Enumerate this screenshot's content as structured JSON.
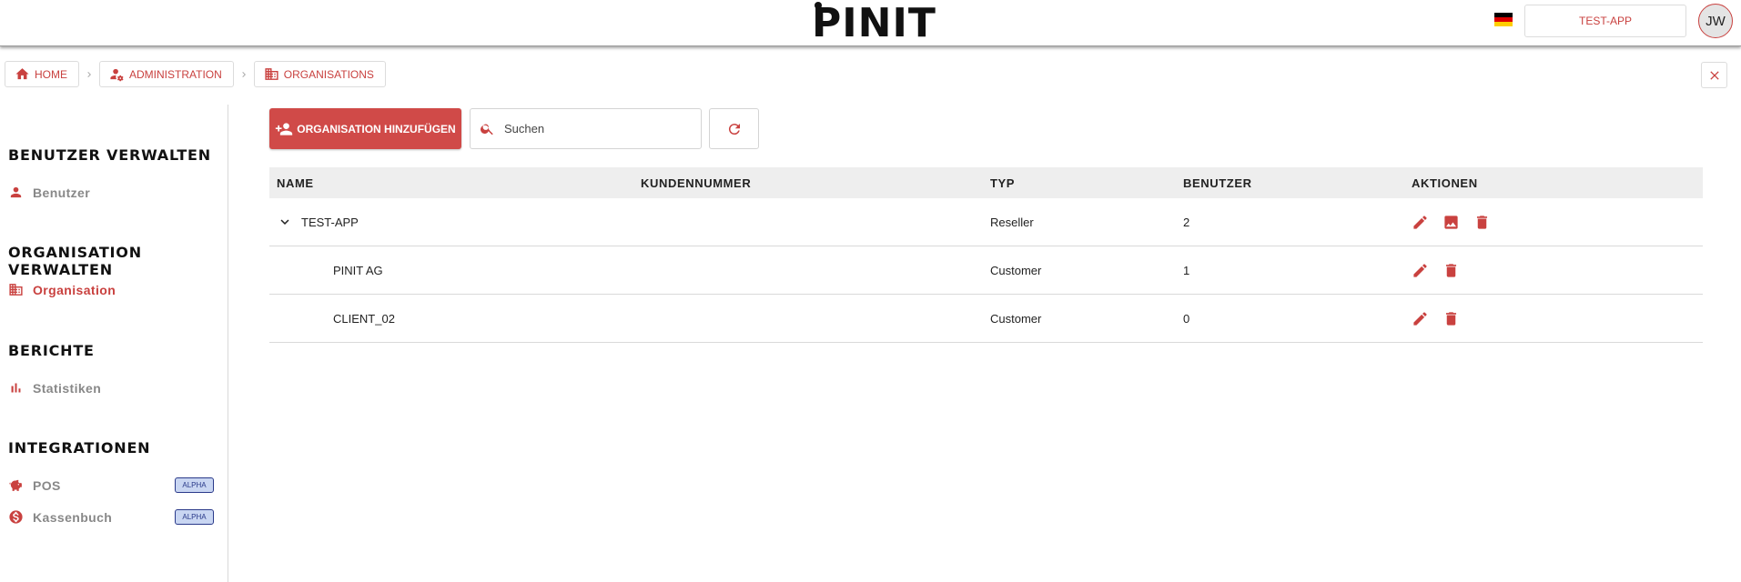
{
  "header": {
    "logo": "PINIT",
    "tenant_button": "TEST-APP",
    "avatar_initials": "JW",
    "flag_colors": [
      "#000000",
      "#dd0000",
      "#ffce00"
    ]
  },
  "breadcrumb": [
    {
      "label": "HOME",
      "icon": "home-icon"
    },
    {
      "label": "ADMINISTRATION",
      "icon": "admin-settings-icon"
    },
    {
      "label": "ORGANISATIONS",
      "icon": "building-icon"
    }
  ],
  "sidebar": {
    "sections": [
      {
        "title": "BENUTZER VERWALTEN",
        "items": [
          {
            "label": "Benutzer",
            "icon": "person-icon"
          }
        ]
      },
      {
        "title": "ORGANISATION VERWALTEN",
        "items": [
          {
            "label": "Organisation",
            "icon": "building-icon",
            "active": true
          }
        ]
      },
      {
        "title": "BERICHTE",
        "items": [
          {
            "label": "Statistiken",
            "icon": "bar-chart-icon"
          }
        ]
      },
      {
        "title": "INTEGRATIONEN",
        "items": [
          {
            "label": "POS",
            "icon": "piggy-bank-icon",
            "badge": "ALPHA"
          },
          {
            "label": "Kassenbuch",
            "icon": "dollar-coin-icon",
            "badge": "ALPHA"
          }
        ]
      }
    ]
  },
  "toolbar": {
    "add_label": "ORGANISATION HINZUFÜGEN",
    "search_placeholder": "Suchen"
  },
  "table": {
    "columns": [
      "NAME",
      "KUNDENNUMMER",
      "TYP",
      "BENUTZER",
      "AKTIONEN"
    ],
    "rows": [
      {
        "name": "TEST-APP",
        "kundennummer": "",
        "typ": "Reseller",
        "benutzer": "2",
        "expandable": true,
        "actions": [
          "edit-icon",
          "image-icon",
          "delete-icon"
        ]
      },
      {
        "name": "PINIT AG",
        "kundennummer": "",
        "typ": "Customer",
        "benutzer": "1",
        "expandable": false,
        "actions": [
          "edit-icon",
          "delete-icon"
        ]
      },
      {
        "name": "CLIENT_02",
        "kundennummer": "",
        "typ": "Customer",
        "benutzer": "0",
        "expandable": false,
        "actions": [
          "edit-icon",
          "delete-icon"
        ]
      }
    ]
  },
  "colors": {
    "accent": "#c9413f",
    "button_fill": "#d04a48",
    "badge_fill": "#c9d6f2"
  }
}
